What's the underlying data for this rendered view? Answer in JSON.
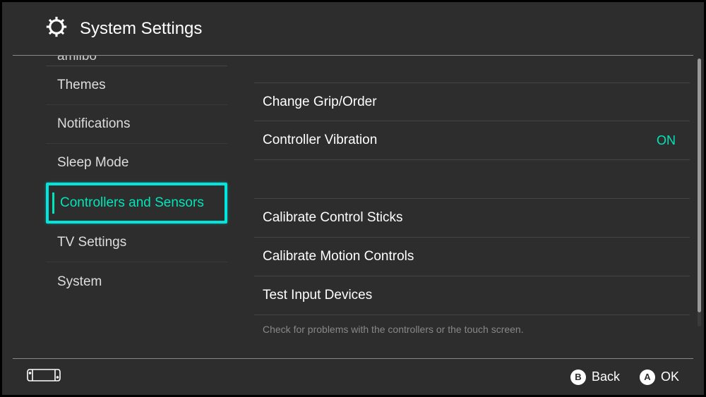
{
  "header": {
    "title": "System Settings"
  },
  "sidebar": {
    "cut_item": "amiibo",
    "items": [
      {
        "label": "Themes"
      },
      {
        "label": "Notifications"
      },
      {
        "label": "Sleep Mode"
      },
      {
        "label": "Controllers and Sensors",
        "selected": true
      },
      {
        "label": "TV Settings"
      },
      {
        "label": "System"
      }
    ]
  },
  "main": {
    "options": [
      {
        "label": "Change Grip/Order"
      },
      {
        "label": "Controller Vibration",
        "value": "ON"
      }
    ],
    "options2": [
      {
        "label": "Calibrate Control Sticks"
      },
      {
        "label": "Calibrate Motion Controls"
      },
      {
        "label": "Test Input Devices"
      }
    ],
    "hint": "Check for problems with the controllers or the touch screen."
  },
  "footer": {
    "back_letter": "B",
    "back_label": "Back",
    "ok_letter": "A",
    "ok_label": "OK"
  }
}
